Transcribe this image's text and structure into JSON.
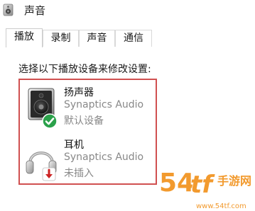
{
  "window": {
    "title": "声音",
    "icon": "speaker-icon"
  },
  "tabs": [
    {
      "label": "播放",
      "active": true
    },
    {
      "label": "录制",
      "active": false
    },
    {
      "label": "声音",
      "active": false
    },
    {
      "label": "通信",
      "active": false
    }
  ],
  "playback": {
    "instructions": "选择以下播放设备来修改设置:",
    "devices": [
      {
        "name": "扬声器",
        "driver": "Synaptics Audio",
        "status": "默认设备",
        "icon": "speaker-device-icon",
        "badge": "default-check-icon"
      },
      {
        "name": "耳机",
        "driver": "Synaptics Audio",
        "status": "未插入",
        "icon": "headphones-device-icon",
        "badge": "unplugged-arrow-icon"
      }
    ]
  },
  "watermark": {
    "text": "54tf 手游网",
    "url_text": "www.54tf.com"
  },
  "colors": {
    "highlight_border": "#d05050",
    "check_badge": "#2aa14a",
    "unplugged_badge": "#cc2222",
    "watermark_orange": "#f29a2e"
  }
}
